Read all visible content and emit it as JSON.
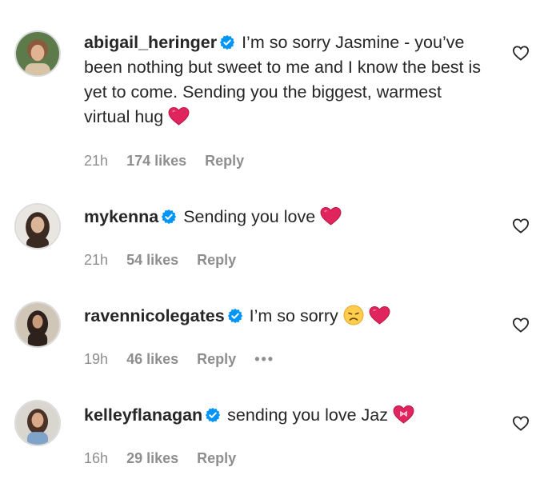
{
  "comments": [
    {
      "username": "abigail_heringer",
      "text": "I’m so sorry Jasmine - you’ve been nothing but sweet to me and I know the best is yet to come. Sending you the biggest, warmest virtual hug",
      "time": "21h",
      "likes": "174 likes",
      "reply": "Reply",
      "emoji": [
        "red-heart"
      ]
    },
    {
      "username": "mykenna",
      "text": "Sending you love",
      "time": "21h",
      "likes": "54 likes",
      "reply": "Reply",
      "emoji": [
        "red-heart"
      ]
    },
    {
      "username": "ravennicolegates",
      "text": "I’m so sorry",
      "time": "19h",
      "likes": "46 likes",
      "reply": "Reply",
      "more": "•••",
      "emoji": [
        "disappointed-face",
        "red-heart"
      ]
    },
    {
      "username": "kelleyflanagan",
      "text": "sending you love Jaz",
      "time": "16h",
      "likes": "29 likes",
      "reply": "Reply",
      "emoji": [
        "heart-with-ribbon"
      ]
    }
  ],
  "colors": {
    "text": "#262626",
    "meta": "#8e8e8e",
    "verified": "#0095f6",
    "heart": "#e0245e"
  }
}
